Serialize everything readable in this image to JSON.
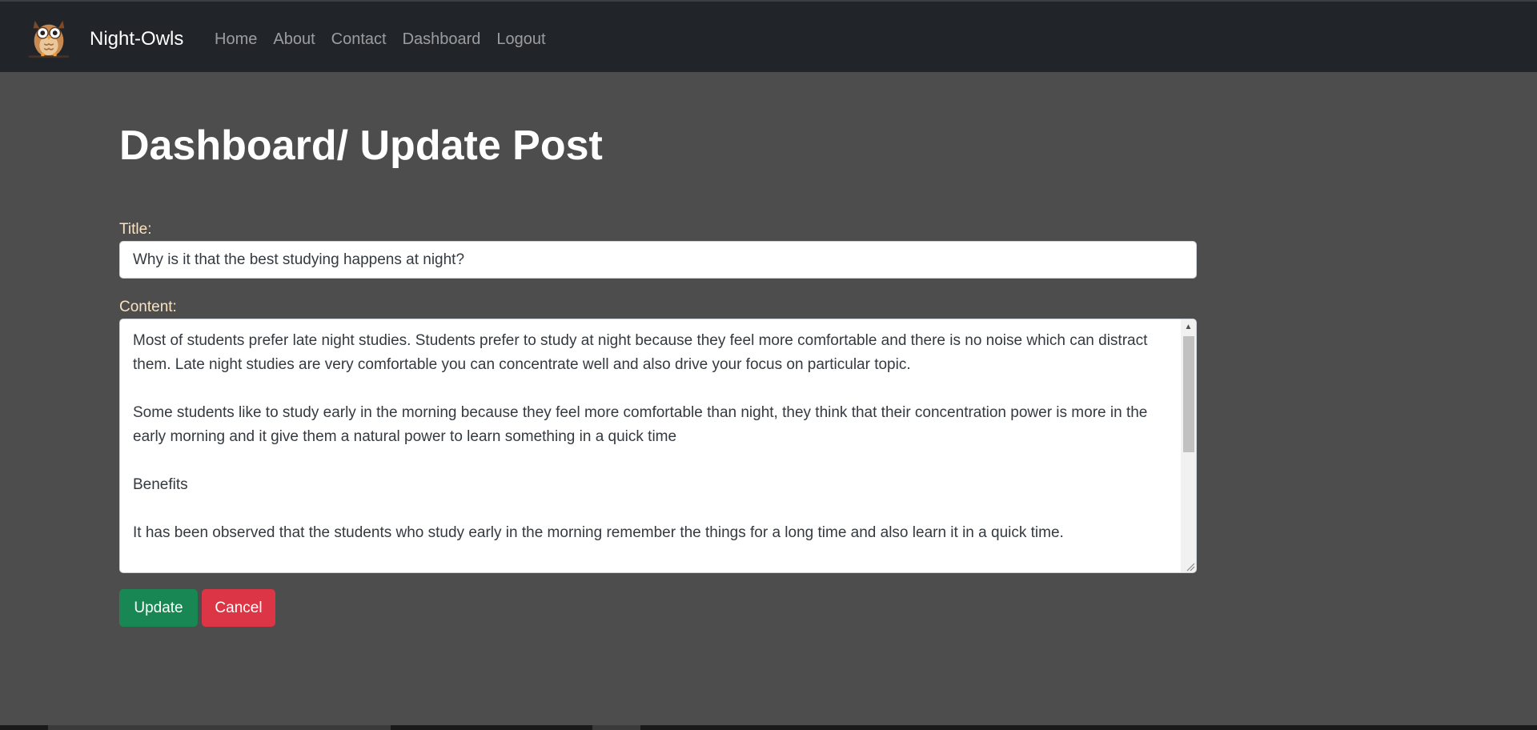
{
  "navbar": {
    "brand": "Night-Owls",
    "logo_icon": "owl-icon",
    "links": [
      "Home",
      "About",
      "Contact",
      "Dashboard",
      "Logout"
    ]
  },
  "page": {
    "title": "Dashboard/ Update Post"
  },
  "form": {
    "title_label": "Title:",
    "title_value": "Why is it that the best studying happens at night?",
    "content_label": "Content:",
    "content_paragraphs": [
      "Most of students prefer late night studies. Students prefer to study at night because they feel more comfortable and there is no noise which can distract them. Late night studies are very comfortable you can concentrate well and also drive your focus on particular topic.",
      "Some students like to study early in the morning because they feel more comfortable than night, they think that their concentration power is more in the early morning and it give them a natural power to learn something in a quick time",
      "Benefits",
      "It has been observed that the students who study early in the morning remember the things for a long time and also learn it in a quick time."
    ],
    "update_label": "Update",
    "cancel_label": "Cancel"
  },
  "colors": {
    "navbar_bg": "#212529",
    "page_bg": "#4d4d4d",
    "label_color": "#f8e3c0",
    "update_btn": "#198754",
    "cancel_btn": "#dc3545"
  }
}
